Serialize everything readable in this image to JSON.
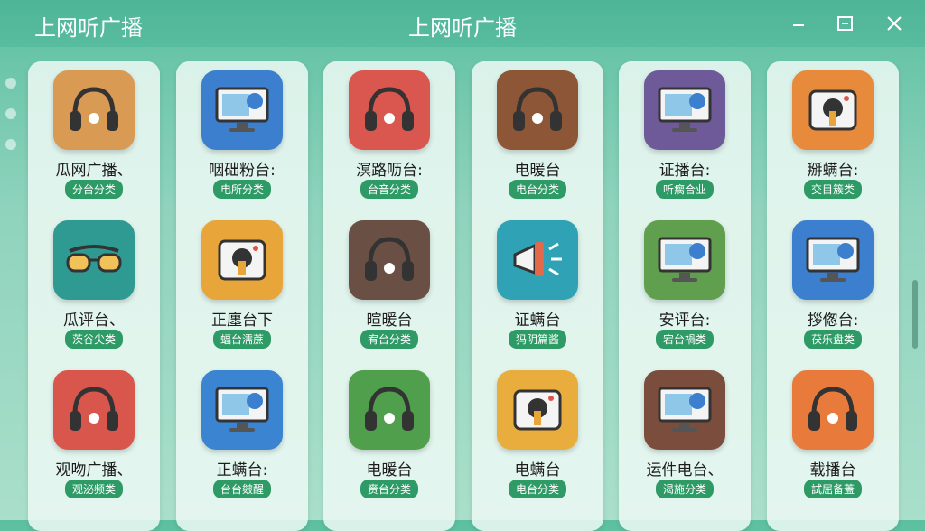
{
  "window": {
    "app_title": "上网听广播",
    "center_title": "上网听广播"
  },
  "colors": {
    "titlebar": "#4fb597",
    "badge": "#2e9a66"
  },
  "grid": [
    [
      {
        "label": "瓜网广播、",
        "badge": "分台分类",
        "color": "#d99a54",
        "icon": "headphones-icon"
      },
      {
        "label": "瓜评台、",
        "badge": "茨谷尖类",
        "color": "#2f9a92",
        "icon": "sunglasses-icon"
      },
      {
        "label": "观吻广播、",
        "badge": "观泌频类",
        "color": "#d9564c",
        "icon": "headphones-icon"
      }
    ],
    [
      {
        "label": "咽础粉台:",
        "badge": "电所分类",
        "color": "#3b7fce",
        "icon": "monitor-icon"
      },
      {
        "label": "正廛台下",
        "badge": "蝠台濡蔗",
        "color": "#e8a63a",
        "icon": "radio-icon"
      },
      {
        "label": "正螨台:",
        "badge": "台台皴醒",
        "color": "#3b84d1",
        "icon": "monitor-icon"
      }
    ],
    [
      {
        "label": "溟路呖台:",
        "badge": "台音分类",
        "color": "#d9574e",
        "icon": "headphones-icon"
      },
      {
        "label": "暄暖台",
        "badge": "宥台分类",
        "color": "#6a4f45",
        "icon": "headphones-icon"
      },
      {
        "label": "电暖台",
        "badge": "赍台分类",
        "color": "#4f9f4c",
        "icon": "headphones-icon"
      }
    ],
    [
      {
        "label": "电暖台",
        "badge": "电台分类",
        "color": "#8c5637",
        "icon": "headphones-icon"
      },
      {
        "label": "证螨台",
        "badge": "犸阴篇酱",
        "color": "#2fa3b5",
        "icon": "megaphone-icon"
      },
      {
        "label": "电螨台",
        "badge": "电台分类",
        "color": "#e8ad3c",
        "icon": "radio-icon"
      }
    ],
    [
      {
        "label": "证播台:",
        "badge": "听瘸合业",
        "color": "#6e5a98",
        "icon": "monitor-icon"
      },
      {
        "label": "安评台:",
        "badge": "宕台禍类",
        "color": "#5f9f4d",
        "icon": "monitor-icon"
      },
      {
        "label": "运件电台、",
        "badge": "渴施分类",
        "color": "#7a4d3c",
        "icon": "monitor-icon"
      }
    ],
    [
      {
        "label": "掰螨台:",
        "badge": "交目簇类",
        "color": "#e88a3c",
        "icon": "radio-icon"
      },
      {
        "label": "拶偬台:",
        "badge": "茯乐盘类",
        "color": "#3b7fce",
        "icon": "monitor-icon"
      },
      {
        "label": "载播台",
        "badge": "試屈备蓋",
        "color": "#e87a3c",
        "icon": "headphones-icon"
      }
    ]
  ]
}
